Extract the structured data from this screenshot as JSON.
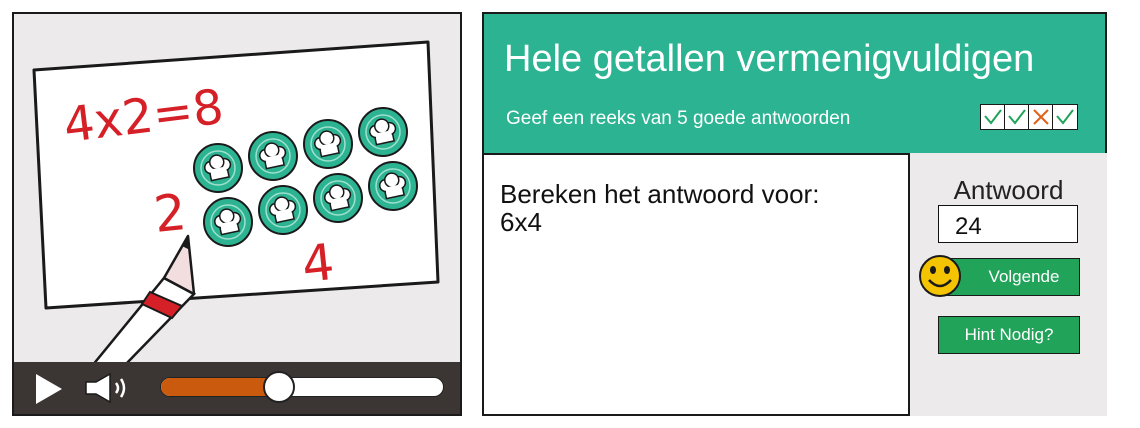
{
  "video": {
    "whiteboard": {
      "equation": "4x2=8",
      "left_number": "2",
      "bottom_number": "4",
      "chips_top_row": 4,
      "chips_bottom_row": 4
    },
    "controls": {
      "play_icon": "play-icon",
      "volume_icon": "speaker-icon",
      "progress_fraction": 0.42,
      "colors": {
        "bar": "#3b3634",
        "progress_fill": "#c95a0e",
        "track": "#ffffff"
      }
    }
  },
  "exercise": {
    "title": "Hele getallen vermenigvuldigen",
    "subtitle": "Geef een reeks van 5 goede antwoorden",
    "streak": [
      "correct",
      "correct",
      "wrong",
      "correct"
    ],
    "question": {
      "prompt": "Bereken het antwoord voor:",
      "expression": "6x4"
    },
    "answer": {
      "label": "Antwoord",
      "value": "24"
    },
    "buttons": {
      "next": "Volgende",
      "hint": "Hint Nodig?"
    },
    "colors": {
      "header": "#2cb392",
      "button": "#22a35a",
      "correct": "#22a35a",
      "wrong": "#e0601a",
      "smiley": "#f5c400"
    }
  }
}
